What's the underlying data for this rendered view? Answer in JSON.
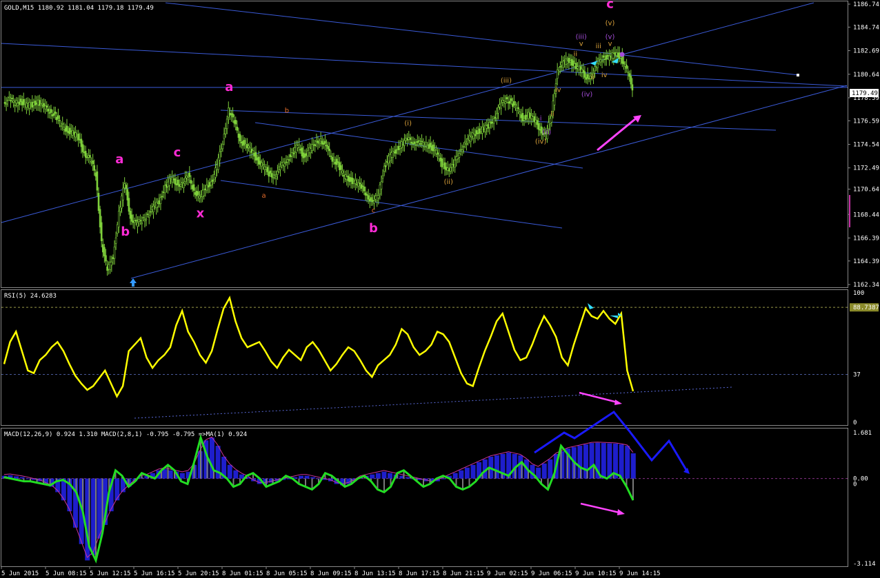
{
  "header": {
    "main": "GOLD,M15  1180.92 1181.04 1179.18 1179.49",
    "rsi": "RSI(5) 24.6283",
    "macd": "MACD(12,26,9) 0.924 1.310  MACD(2,8,1) -0.795 -0.795  =>MA(1) 0.924"
  },
  "colors": {
    "background": "#000000",
    "axis": "#ffffff",
    "candle_up": "#000000",
    "candle_down": "#7fd13b",
    "channel": "#3b5bd9",
    "wave_major": "#ff2bd6",
    "wave_minor": "#e06a2a",
    "wave_sub": "#d9a03a",
    "wave_micro": "#a44dd9",
    "rsi_line": "#ffff00",
    "macd_hist": "#1e1ecc",
    "macd_line": "#22dd22",
    "signal": "#ff44ff"
  },
  "chart_data": {
    "type": "candlestick",
    "symbol": "GOLD",
    "timeframe": "M15",
    "ohlc_last": {
      "open": 1180.92,
      "high": 1181.04,
      "low": 1179.18,
      "close": 1179.49
    },
    "current_price": "1179.49",
    "ylim": [
      1162.34,
      1186.74
    ],
    "yticks": [
      "1186.74",
      "1184.74",
      "1182.69",
      "1180.64",
      "1178.59",
      "1176.59",
      "1174.54",
      "1172.49",
      "1170.64",
      "1168.44",
      "1166.39",
      "1164.39",
      "1162.34"
    ],
    "xticks": [
      "5 Jun 2015",
      "5 Jun 08:15",
      "5 Jun 12:15",
      "5 Jun 16:15",
      "5 Jun 20:15",
      "8 Jun 01:15",
      "8 Jun 05:15",
      "8 Jun 09:15",
      "8 Jun 13:15",
      "8 Jun 17:15",
      "8 Jun 21:15",
      "9 Jun 02:15",
      "9 Jun 06:15",
      "9 Jun 10:15",
      "9 Jun 14:15"
    ],
    "price_path": [
      1178.2,
      1178.4,
      1178.1,
      1178.3,
      1177.9,
      1178.0,
      1178.3,
      1177.7,
      1177.5,
      1177.0,
      1176.2,
      1175.8,
      1175.5,
      1175.1,
      1173.8,
      1173.2,
      1172.0,
      1166.0,
      1163.5,
      1164.8,
      1168.5,
      1171.2,
      1168.2,
      1167.6,
      1167.9,
      1168.4,
      1169.0,
      1169.6,
      1170.8,
      1171.5,
      1171.2,
      1171.0,
      1171.8,
      1170.6,
      1169.8,
      1170.8,
      1171.2,
      1172.6,
      1174.8,
      1177.5,
      1176.4,
      1175.0,
      1174.3,
      1174.0,
      1173.2,
      1172.6,
      1172.0,
      1171.8,
      1172.5,
      1173.2,
      1173.6,
      1174.5,
      1173.5,
      1174.0,
      1174.6,
      1175.0,
      1174.2,
      1173.3,
      1172.8,
      1171.7,
      1171.5,
      1171.2,
      1170.8,
      1170.2,
      1169.3,
      1170.3,
      1172.6,
      1173.5,
      1174.0,
      1174.6,
      1174.9,
      1174.8,
      1174.6,
      1174.5,
      1174.4,
      1173.8,
      1172.8,
      1172.4,
      1172.6,
      1174.0,
      1174.6,
      1175.2,
      1175.6,
      1175.8,
      1176.1,
      1176.8,
      1177.8,
      1178.5,
      1178.2,
      1177.6,
      1176.8,
      1177.1,
      1176.6,
      1175.9,
      1175.2,
      1177.2,
      1181.0,
      1181.6,
      1181.9,
      1181.4,
      1181.0,
      1180.4,
      1180.5,
      1181.7,
      1182.2,
      1182.0,
      1182.5,
      1182.1,
      1181.0,
      1179.5
    ],
    "annotations_major": [
      {
        "text": "a",
        "x_idx": 20,
        "price": 1172.9
      },
      {
        "text": "b",
        "x_idx": 21,
        "price": 1166.6
      },
      {
        "text": "c",
        "x_idx": 30,
        "price": 1173.5
      },
      {
        "text": "x",
        "x_idx": 34,
        "price": 1168.2
      },
      {
        "text": "a",
        "x_idx": 39,
        "price": 1179.2
      },
      {
        "text": "b",
        "x_idx": 64,
        "price": 1166.9
      },
      {
        "text": "c",
        "x_idx": 105,
        "price": 1186.4
      }
    ],
    "annotations_minor": [
      {
        "text": "b",
        "x_idx": 49,
        "price": 1177.3,
        "group": "minor"
      },
      {
        "text": "a",
        "x_idx": 45,
        "price": 1169.9,
        "group": "minor"
      },
      {
        "text": "c",
        "x_idx": 64,
        "price": 1168.6,
        "group": "minor"
      },
      {
        "text": "(i)",
        "x_idx": 70,
        "price": 1176.2,
        "group": "sub"
      },
      {
        "text": "(ii)",
        "x_idx": 77,
        "price": 1171.1,
        "group": "sub"
      },
      {
        "text": "(iii)",
        "x_idx": 87,
        "price": 1179.9,
        "group": "sub"
      },
      {
        "text": "(iv)",
        "x_idx": 93,
        "price": 1174.6,
        "group": "sub"
      },
      {
        "text": "(v)",
        "x_idx": 105,
        "price": 1184.9,
        "group": "sub"
      },
      {
        "text": "(iii)",
        "x_idx": 100,
        "price": 1183.7,
        "group": "micro"
      },
      {
        "text": "(iv)",
        "x_idx": 101,
        "price": 1178.7,
        "group": "micro"
      },
      {
        "text": "(v)",
        "x_idx": 105,
        "price": 1183.7,
        "group": "micro"
      },
      {
        "text": "i",
        "x_idx": 93,
        "price": 1176.6,
        "group": "micro"
      },
      {
        "text": "(ii)",
        "x_idx": 94,
        "price": 1175.4,
        "group": "micro"
      },
      {
        "text": "ii",
        "x_idx": 99,
        "price": 1182.2,
        "group": "sub"
      },
      {
        "text": "ii",
        "x_idx": 95,
        "price": 1177.0,
        "group": "sub"
      },
      {
        "text": "iii",
        "x_idx": 103,
        "price": 1182.9,
        "group": "sub"
      },
      {
        "text": "iv",
        "x_idx": 96,
        "price": 1179.1,
        "group": "sub"
      },
      {
        "text": "iv",
        "x_idx": 104,
        "price": 1180.4,
        "group": "sub"
      },
      {
        "text": "v",
        "x_idx": 100,
        "price": 1183.1,
        "group": "sub"
      },
      {
        "text": "v",
        "x_idx": 105,
        "price": 1183.1,
        "group": "sub"
      },
      {
        "text": "ii",
        "x_idx": 102,
        "price": 1180.2,
        "group": "sub"
      }
    ],
    "rsi": {
      "ylim": [
        0,
        100
      ],
      "yticks": [
        "100",
        "88.7387",
        "37",
        "0"
      ],
      "values": [
        45,
        62,
        70,
        55,
        40,
        38,
        48,
        52,
        58,
        62,
        55,
        45,
        36,
        30,
        25,
        28,
        34,
        40,
        30,
        20,
        28,
        55,
        60,
        65,
        50,
        42,
        48,
        52,
        58,
        75,
        86,
        70,
        62,
        52,
        46,
        55,
        72,
        88,
        96,
        78,
        65,
        58,
        60,
        62,
        55,
        47,
        42,
        50,
        56,
        52,
        48,
        58,
        62,
        56,
        48,
        40,
        45,
        52,
        58,
        55,
        48,
        40,
        35,
        44,
        48,
        52,
        60,
        72,
        68,
        58,
        52,
        55,
        60,
        70,
        68,
        62,
        50,
        38,
        30,
        28,
        42,
        55,
        66,
        78,
        84,
        70,
        56,
        48,
        50,
        60,
        72,
        82,
        75,
        66,
        50,
        44,
        60,
        74,
        88,
        82,
        80,
        86,
        80,
        76,
        84,
        40,
        24
      ]
    },
    "macd": {
      "ylim": [
        -3.114,
        1.681
      ],
      "yticks": [
        "1.681",
        "0.00",
        "0",
        "-3.114"
      ],
      "hist": [
        0.1,
        0.12,
        0.08,
        0.05,
        0.0,
        -0.05,
        -0.1,
        -0.2,
        -0.3,
        -0.5,
        -0.8,
        -1.2,
        -1.8,
        -2.4,
        -3.0,
        -2.8,
        -2.2,
        -1.7,
        -1.2,
        -0.8,
        -0.5,
        -0.3,
        -0.1,
        0.05,
        0.1,
        0.2,
        0.3,
        0.35,
        0.3,
        0.25,
        0.2,
        0.25,
        0.5,
        1.0,
        1.4,
        1.5,
        1.2,
        0.8,
        0.5,
        0.3,
        0.15,
        0.05,
        -0.1,
        -0.2,
        -0.2,
        -0.15,
        -0.1,
        -0.05,
        0.0,
        0.05,
        0.1,
        0.1,
        0.05,
        0.0,
        -0.05,
        -0.1,
        -0.2,
        -0.25,
        -0.2,
        -0.1,
        0.05,
        0.1,
        0.15,
        0.2,
        0.25,
        0.2,
        0.15,
        0.1,
        0.05,
        0.0,
        -0.05,
        -0.1,
        -0.15,
        -0.1,
        0.0,
        0.1,
        0.2,
        0.3,
        0.4,
        0.5,
        0.6,
        0.7,
        0.8,
        0.85,
        0.9,
        0.95,
        0.9,
        0.85,
        0.7,
        0.5,
        0.4,
        0.55,
        0.7,
        0.9,
        1.0,
        1.1,
        1.15,
        1.2,
        1.25,
        1.3,
        1.31,
        1.3,
        1.29,
        1.28,
        1.25,
        1.2,
        0.924
      ],
      "line": [
        0.05,
        0.0,
        -0.05,
        -0.1,
        -0.1,
        -0.15,
        -0.2,
        -0.25,
        -0.1,
        -0.05,
        -0.2,
        -0.5,
        -1.2,
        -2.5,
        -3.0,
        -2.0,
        -0.5,
        0.3,
        0.1,
        -0.3,
        -0.1,
        0.2,
        0.1,
        0.0,
        0.3,
        0.5,
        0.3,
        -0.1,
        -0.2,
        0.6,
        1.5,
        0.8,
        0.3,
        0.2,
        0.0,
        -0.3,
        -0.2,
        0.1,
        0.2,
        0.0,
        -0.3,
        -0.2,
        -0.1,
        0.1,
        0.0,
        -0.2,
        -0.3,
        -0.4,
        -0.2,
        0.2,
        0.1,
        -0.1,
        -0.3,
        -0.2,
        0.0,
        0.1,
        -0.1,
        -0.4,
        -0.5,
        -0.3,
        0.2,
        0.3,
        0.1,
        -0.1,
        -0.3,
        -0.2,
        0.0,
        0.1,
        0.0,
        -0.3,
        -0.4,
        -0.3,
        -0.1,
        0.2,
        0.4,
        0.3,
        0.2,
        0.1,
        0.4,
        0.6,
        0.3,
        0.1,
        -0.2,
        -0.4,
        0.2,
        1.2,
        0.9,
        0.6,
        0.4,
        0.3,
        0.5,
        0.1,
        0.0,
        0.2,
        0.1,
        -0.3,
        -0.795
      ]
    }
  }
}
